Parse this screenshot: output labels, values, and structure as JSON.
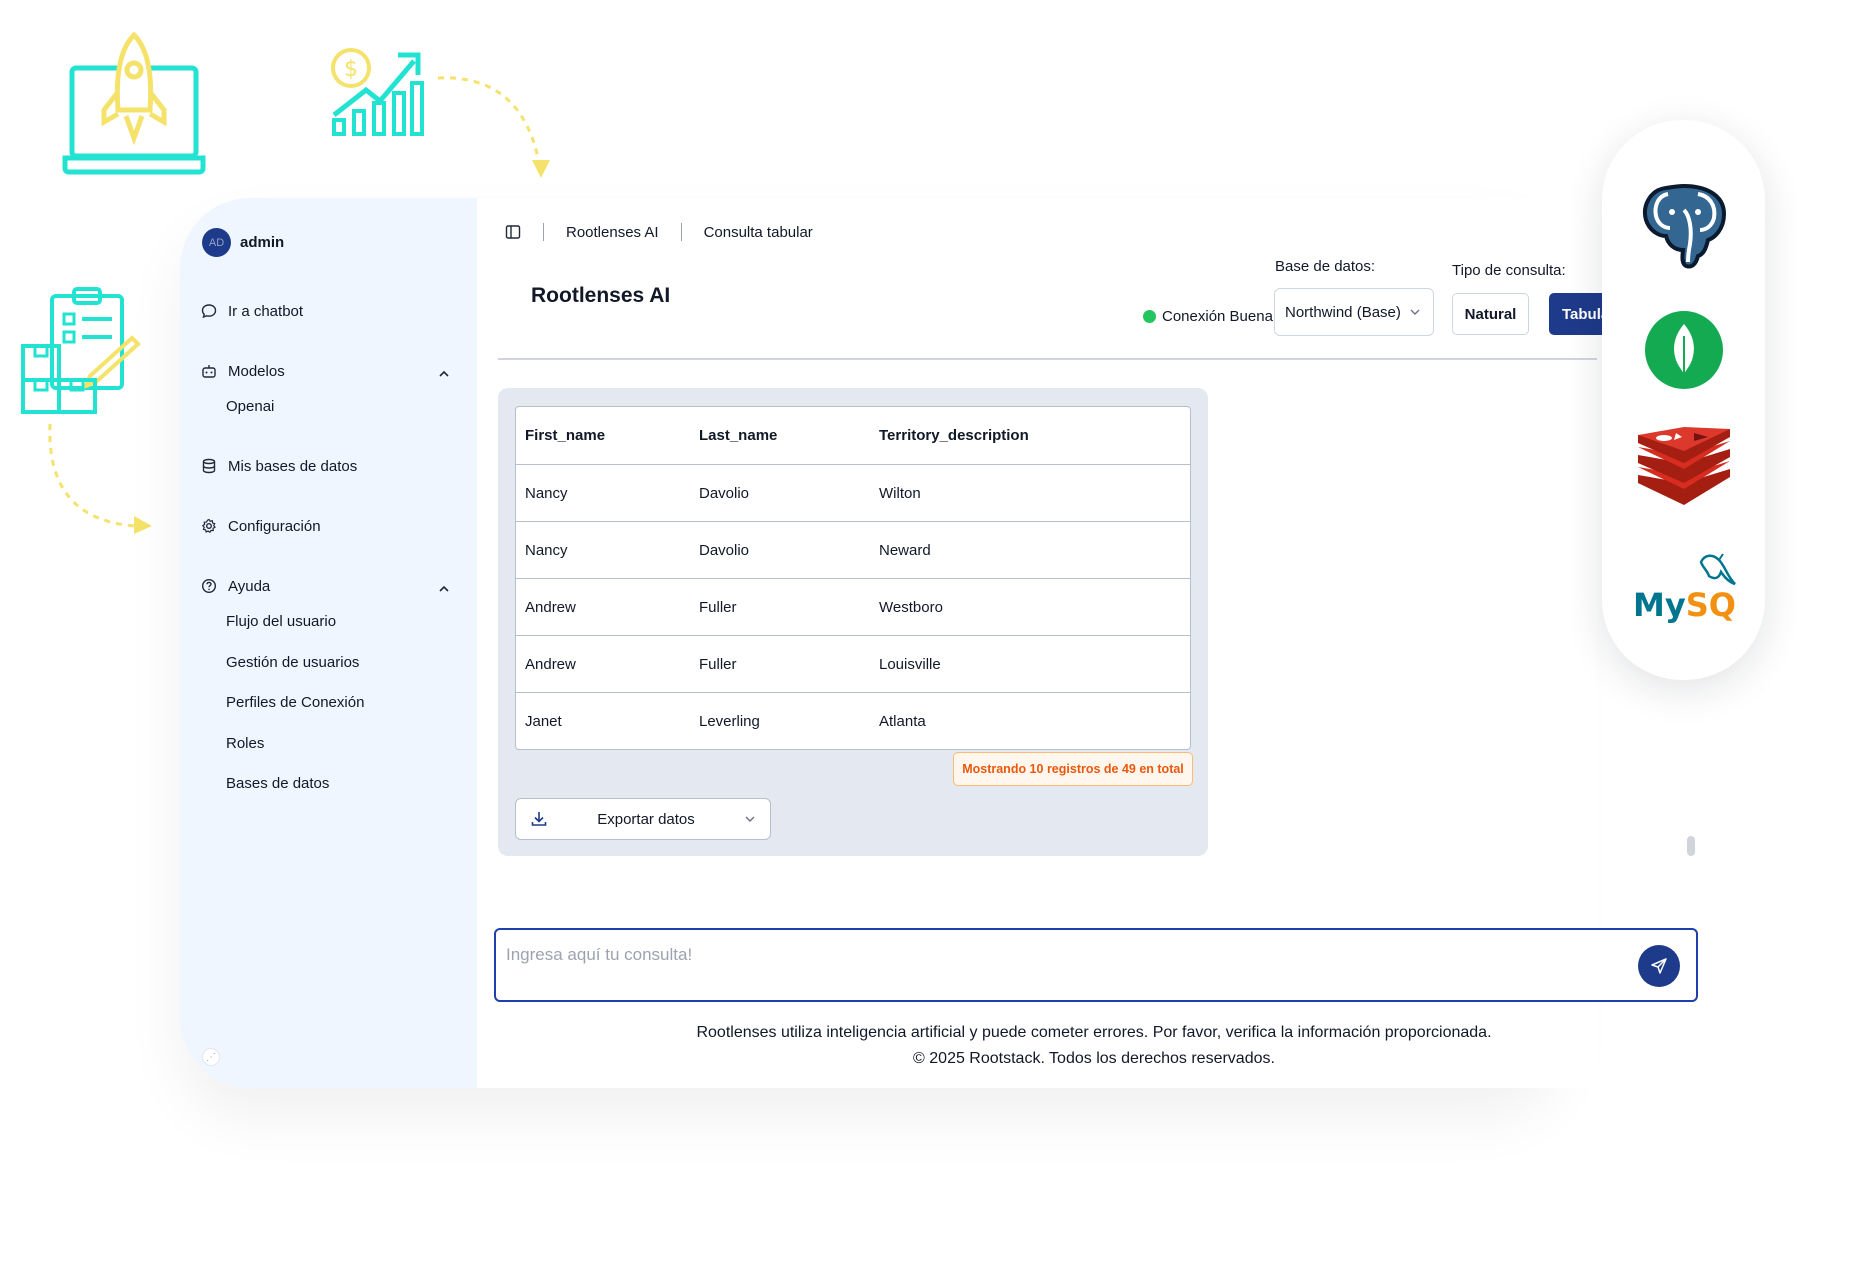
{
  "user": {
    "initials": "AD",
    "name": "admin"
  },
  "sidebar": {
    "chatbot": "Ir a chatbot",
    "models": {
      "label": "Modelos",
      "items": [
        "Openai"
      ]
    },
    "my_databases": "Mis bases de datos",
    "settings": "Configuración",
    "help": {
      "label": "Ayuda",
      "items": [
        "Flujo del usuario",
        "Gestión de usuarios",
        "Perfiles de Conexión",
        "Roles",
        "Bases de datos"
      ]
    }
  },
  "breadcrumb": {
    "app": "Rootlenses AI",
    "page": "Consulta tabular"
  },
  "page_title": "Rootlenses AI",
  "connection": {
    "status": "Conexión Buena",
    "color": "#22c55e"
  },
  "database": {
    "label": "Base de datos:",
    "selected": "Northwind (Base)"
  },
  "query_type": {
    "label": "Tipo de consulta:",
    "natural": "Natural",
    "tabular": "Tabular"
  },
  "table": {
    "headers": [
      "First_name",
      "Last_name",
      "Territory_description"
    ],
    "rows": [
      [
        "Nancy",
        "Davolio",
        "Wilton"
      ],
      [
        "Nancy",
        "Davolio",
        "Neward"
      ],
      [
        "Andrew",
        "Fuller",
        "Westboro"
      ],
      [
        "Andrew",
        "Fuller",
        "Louisville"
      ],
      [
        "Janet",
        "Leverling",
        "Atlanta"
      ]
    ]
  },
  "records_badge": "Mostrando 10 registros de 49 en total",
  "export": "Exportar datos",
  "query": {
    "placeholder": "Ingresa aquí tu consulta!"
  },
  "footer": {
    "disclaimer": "Rootlenses utiliza inteligencia artificial y puede cometer errores. Por favor, verifica la información proporcionada.",
    "copyright": "© 2025 Rootstack. Todos los derechos reservados."
  },
  "logos": {
    "mysql_text": "MySQL"
  },
  "colors": {
    "accent": "#1e3a8a",
    "sidebar_bg": "#f0f6ff",
    "deco_cyan": "#22e3d2",
    "deco_yellow": "#f5e26a"
  }
}
